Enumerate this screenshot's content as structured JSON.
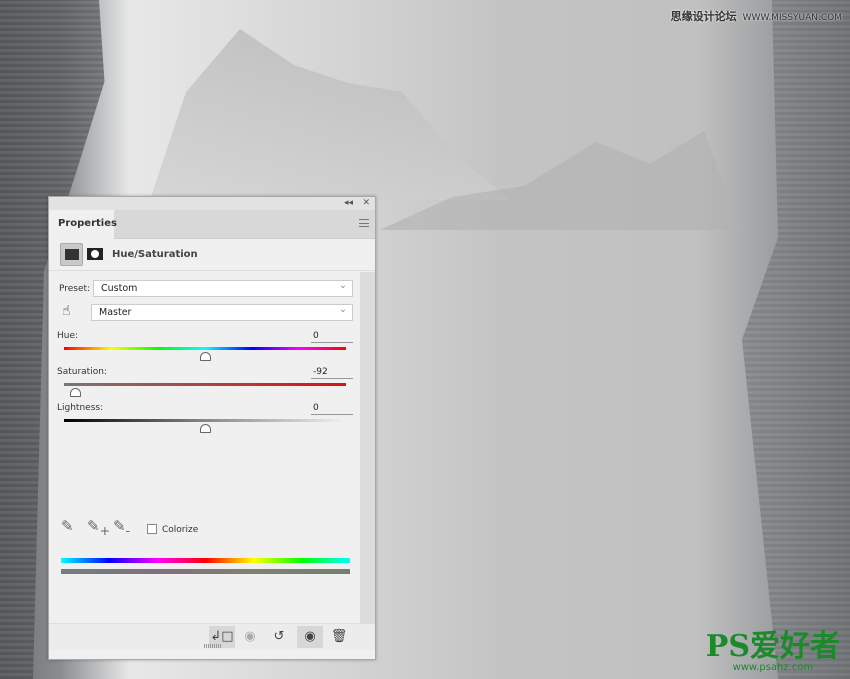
{
  "watermark_top": {
    "cn": "思缘设计论坛",
    "url": "WWW.MISSYUAN.COM"
  },
  "watermark_bottom": {
    "logo": "PS爱好者",
    "url": "www.psahz.com"
  },
  "panel": {
    "tab": "Properties",
    "title": "Hue/Saturation",
    "preset_label": "Preset:",
    "preset_value": "Custom",
    "channel_value": "Master",
    "hue": {
      "label": "Hue:",
      "value": "0",
      "fraction": 0.5
    },
    "saturation": {
      "label": "Saturation:",
      "value": "-92",
      "fraction": 0.04
    },
    "lightness": {
      "label": "Lightness:",
      "value": "0",
      "fraction": 0.5
    },
    "colorize_label": "Colorize",
    "colorize_checked": false,
    "icons": [
      "collapse-icon",
      "close-icon",
      "panel-menu-icon",
      "adjustment-icon",
      "mask-icon",
      "targeted-adjustment-hand-icon",
      "eyedropper-icon",
      "eyedropper-plus-icon",
      "eyedropper-minus-icon",
      "clip-to-layer-icon",
      "view-previous-state-icon",
      "reset-icon",
      "visibility-eye-icon",
      "trash-icon"
    ]
  }
}
